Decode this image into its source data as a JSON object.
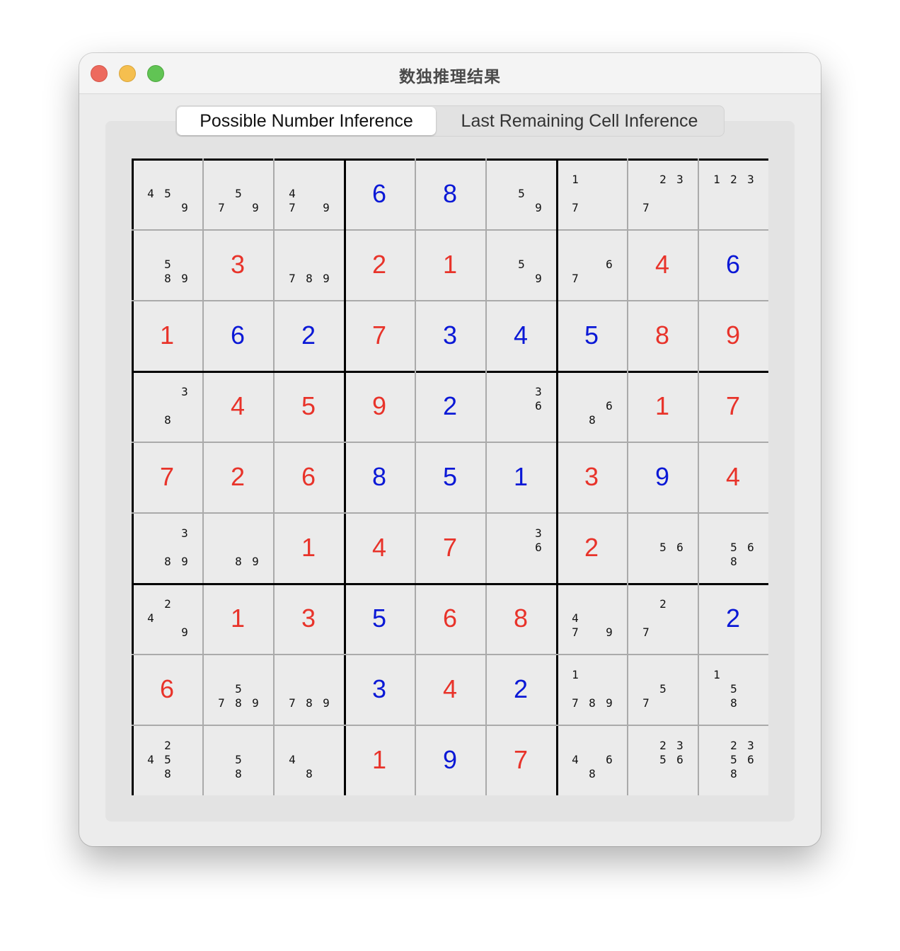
{
  "window": {
    "title": "数独推理结果"
  },
  "tabs": [
    {
      "label": "Possible Number Inference",
      "selected": true
    },
    {
      "label": "Last Remaining Cell Inference",
      "selected": false
    }
  ],
  "colors": {
    "given": "#0a18d6",
    "inferred": "#e8332a",
    "candidate": "#111111"
  },
  "grid": [
    [
      {
        "c": [
          4,
          5,
          9
        ]
      },
      {
        "c": [
          5,
          7,
          9
        ]
      },
      {
        "c": [
          4,
          7,
          9
        ]
      },
      {
        "v": 6,
        "k": "given"
      },
      {
        "v": 8,
        "k": "given"
      },
      {
        "c": [
          5,
          9
        ]
      },
      {
        "c": [
          1,
          7
        ]
      },
      {
        "c": [
          2,
          3,
          7
        ]
      },
      {
        "c": [
          1,
          2,
          3
        ]
      }
    ],
    [
      {
        "c": [
          5,
          8,
          9
        ]
      },
      {
        "v": 3,
        "k": "inferred"
      },
      {
        "c": [
          7,
          8,
          9
        ]
      },
      {
        "v": 2,
        "k": "inferred"
      },
      {
        "v": 1,
        "k": "inferred"
      },
      {
        "c": [
          5,
          9
        ]
      },
      {
        "c": [
          6,
          7
        ]
      },
      {
        "v": 4,
        "k": "inferred"
      },
      {
        "v": 6,
        "k": "given"
      }
    ],
    [
      {
        "v": 1,
        "k": "inferred"
      },
      {
        "v": 6,
        "k": "given"
      },
      {
        "v": 2,
        "k": "given"
      },
      {
        "v": 7,
        "k": "inferred"
      },
      {
        "v": 3,
        "k": "given"
      },
      {
        "v": 4,
        "k": "given"
      },
      {
        "v": 5,
        "k": "given"
      },
      {
        "v": 8,
        "k": "inferred"
      },
      {
        "v": 9,
        "k": "inferred"
      }
    ],
    [
      {
        "c": [
          3,
          8
        ]
      },
      {
        "v": 4,
        "k": "inferred"
      },
      {
        "v": 5,
        "k": "inferred"
      },
      {
        "v": 9,
        "k": "inferred"
      },
      {
        "v": 2,
        "k": "given"
      },
      {
        "c": [
          3,
          6
        ]
      },
      {
        "c": [
          6,
          8
        ]
      },
      {
        "v": 1,
        "k": "inferred"
      },
      {
        "v": 7,
        "k": "inferred"
      }
    ],
    [
      {
        "v": 7,
        "k": "inferred"
      },
      {
        "v": 2,
        "k": "inferred"
      },
      {
        "v": 6,
        "k": "inferred"
      },
      {
        "v": 8,
        "k": "given"
      },
      {
        "v": 5,
        "k": "given"
      },
      {
        "v": 1,
        "k": "given"
      },
      {
        "v": 3,
        "k": "inferred"
      },
      {
        "v": 9,
        "k": "given"
      },
      {
        "v": 4,
        "k": "inferred"
      }
    ],
    [
      {
        "c": [
          3,
          8,
          9
        ]
      },
      {
        "c": [
          8,
          9
        ]
      },
      {
        "v": 1,
        "k": "inferred"
      },
      {
        "v": 4,
        "k": "inferred"
      },
      {
        "v": 7,
        "k": "inferred"
      },
      {
        "c": [
          3,
          6
        ]
      },
      {
        "v": 2,
        "k": "inferred"
      },
      {
        "c": [
          5,
          6
        ]
      },
      {
        "c": [
          5,
          6,
          8
        ]
      }
    ],
    [
      {
        "c": [
          2,
          4,
          9
        ]
      },
      {
        "v": 1,
        "k": "inferred"
      },
      {
        "v": 3,
        "k": "inferred"
      },
      {
        "v": 5,
        "k": "given"
      },
      {
        "v": 6,
        "k": "inferred"
      },
      {
        "v": 8,
        "k": "inferred"
      },
      {
        "c": [
          4,
          7,
          9
        ]
      },
      {
        "c": [
          2,
          7
        ]
      },
      {
        "v": 2,
        "k": "given"
      }
    ],
    [
      {
        "v": 6,
        "k": "inferred"
      },
      {
        "c": [
          5,
          7,
          8,
          9
        ]
      },
      {
        "c": [
          7,
          8,
          9
        ]
      },
      {
        "v": 3,
        "k": "given"
      },
      {
        "v": 4,
        "k": "inferred"
      },
      {
        "v": 2,
        "k": "given"
      },
      {
        "c": [
          1,
          7,
          8,
          9
        ]
      },
      {
        "c": [
          5,
          7
        ]
      },
      {
        "c": [
          1,
          5,
          8
        ]
      }
    ],
    [
      {
        "c": [
          2,
          4,
          5,
          8
        ]
      },
      {
        "c": [
          5,
          8
        ]
      },
      {
        "c": [
          4,
          8
        ]
      },
      {
        "v": 1,
        "k": "inferred"
      },
      {
        "v": 9,
        "k": "given"
      },
      {
        "v": 7,
        "k": "inferred"
      },
      {
        "c": [
          4,
          6,
          8
        ]
      },
      {
        "c": [
          2,
          3,
          5,
          6
        ]
      },
      {
        "c": [
          2,
          3,
          5,
          6,
          8
        ]
      }
    ]
  ]
}
